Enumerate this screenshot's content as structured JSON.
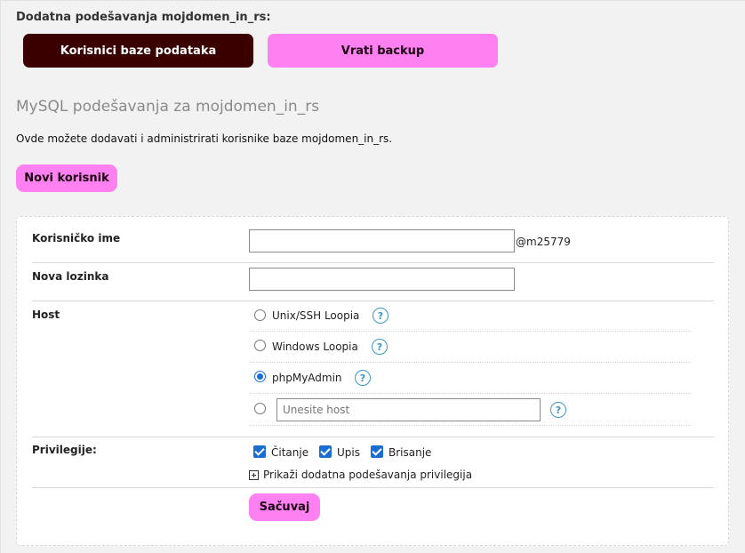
{
  "header": {
    "title": "Dodatna podešavanja mojdomen_in_rs:",
    "db_users_button": "Korisnici baze podataka",
    "restore_backup_button": "Vrati backup"
  },
  "section": {
    "title": "MySQL podešavanja za mojdomen_in_rs",
    "description": "Ovde možete dodavati i administrirati korisnike baze mojdomen_in_rs.",
    "new_user_button": "Novi korisnik"
  },
  "form": {
    "username_label": "Korisničko ime",
    "username_value": "",
    "username_suffix": "@m25779",
    "password_label": "Nova lozinka",
    "password_value": "",
    "host_label": "Host",
    "host_options": [
      {
        "label": "Unix/SSH Loopia",
        "selected": false
      },
      {
        "label": "Windows Loopia",
        "selected": false
      },
      {
        "label": "phpMyAdmin",
        "selected": true
      }
    ],
    "custom_host_placeholder": "Unesite host",
    "help_glyph": "?",
    "privileges_label": "Privilegije:",
    "privileges": [
      {
        "label": "Čitanje",
        "checked": true
      },
      {
        "label": "Upis",
        "checked": true
      },
      {
        "label": "Brisanje",
        "checked": true
      }
    ],
    "more_privileges_link": "Prikaži dodatna podešavanja privilegija",
    "save_button": "Sačuvaj"
  },
  "colors": {
    "dark_button": "#3a0000",
    "pink_button": "#ff80f0",
    "accent_blue": "#1a6dd1",
    "help_icon": "#3b98c0"
  },
  "icons": {
    "help": "question-circle-icon",
    "expand": "plus-square-icon"
  }
}
